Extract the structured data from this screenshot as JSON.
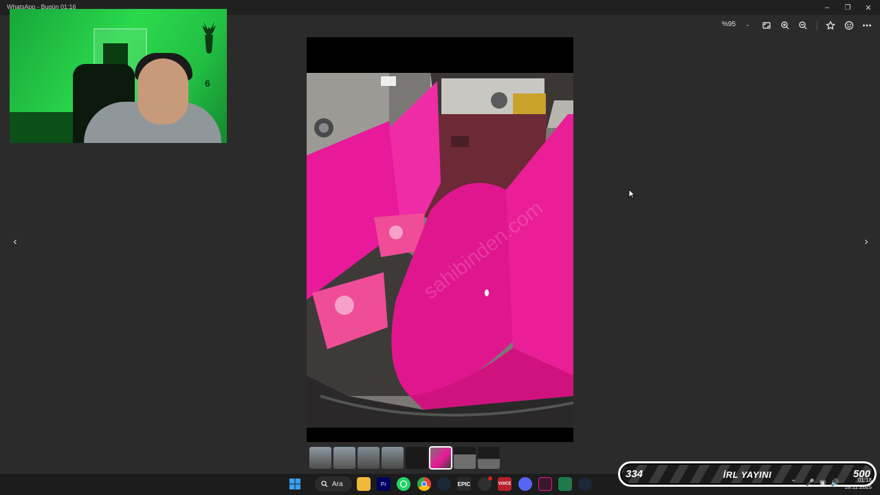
{
  "window": {
    "title": "WhatsApp - Bugün 01:16"
  },
  "toolbar": {
    "zoom_level": "%95",
    "icons": [
      "fit-screen-icon",
      "zoom-in-icon",
      "zoom-out-icon",
      "star-icon",
      "smiley-icon",
      "more-icon"
    ]
  },
  "navigation": {
    "prev": "‹",
    "next": "›"
  },
  "filmstrip": {
    "count": 8,
    "selected_index": 5
  },
  "taskbar": {
    "search_label": "Ara",
    "apps": [
      "windows-start",
      "search",
      "file-explorer",
      "premiere-pro",
      "whatsapp",
      "chrome",
      "steam",
      "epic-games",
      "obs",
      "voicemeeter",
      "discord",
      "app-pink",
      "app-green",
      "steam-2"
    ],
    "epic_label": "EPIC",
    "premiere_label": "Pr",
    "voicemeeter_label": "VOICE"
  },
  "overlay": {
    "left_count": "334",
    "label": "İRL YAYINI",
    "right_count": "500"
  },
  "clock": {
    "time": "01:18",
    "date": "18.11.2025"
  },
  "colors": {
    "background": "#2b2b2b",
    "titlebar": "#202020",
    "taskbar": "#1c1c1c",
    "accent_pink": "#e8199a",
    "webcam_green": "#2bd94d"
  }
}
